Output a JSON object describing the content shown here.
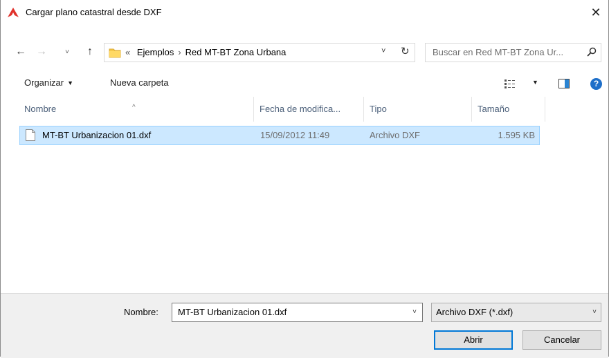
{
  "window": {
    "title": "Cargar plano catastral desde DXF",
    "close_glyph": "✕",
    "icon": "app-logo-icon"
  },
  "navigation": {
    "back_glyph": "←",
    "forward_glyph": "→",
    "recent_glyph": "˅",
    "up_glyph": "↑",
    "breadcrumb": {
      "prefix": "«",
      "items": [
        "Ejemplos",
        "Red MT-BT Zona Urbana"
      ],
      "separator": "›"
    },
    "dropdown_glyph": "˅",
    "refresh_glyph": "↻"
  },
  "search": {
    "placeholder": "Buscar en Red MT-BT Zona Ur..."
  },
  "toolbar": {
    "organize_label": "Organizar",
    "organize_caret": "▼",
    "new_folder_label": "Nueva carpeta",
    "view_caret": "▼",
    "help_glyph": "?"
  },
  "file_list": {
    "columns": {
      "name": "Nombre",
      "date": "Fecha de modifica...",
      "type": "Tipo",
      "size": "Tamaño"
    },
    "sort_glyph": "^",
    "rows": [
      {
        "name": "MT-BT Urbanizacion 01.dxf",
        "date": "15/09/2012 11:49",
        "type": "Archivo DXF",
        "size": "1.595 KB",
        "selected": true
      }
    ]
  },
  "footer": {
    "filename_label": "Nombre:",
    "filename_value": "MT-BT Urbanizacion 01.dxf",
    "filetype_value": "Archivo DXF (*.dxf)",
    "dropdown_glyph": "˅",
    "open_label": "Abrir",
    "cancel_label": "Cancelar"
  },
  "colors": {
    "selection_bg": "#cce8ff",
    "selection_border": "#99d1ff",
    "accent": "#0078d7",
    "help_icon": "#1e6fc9",
    "app_icon": "#e0322c"
  }
}
